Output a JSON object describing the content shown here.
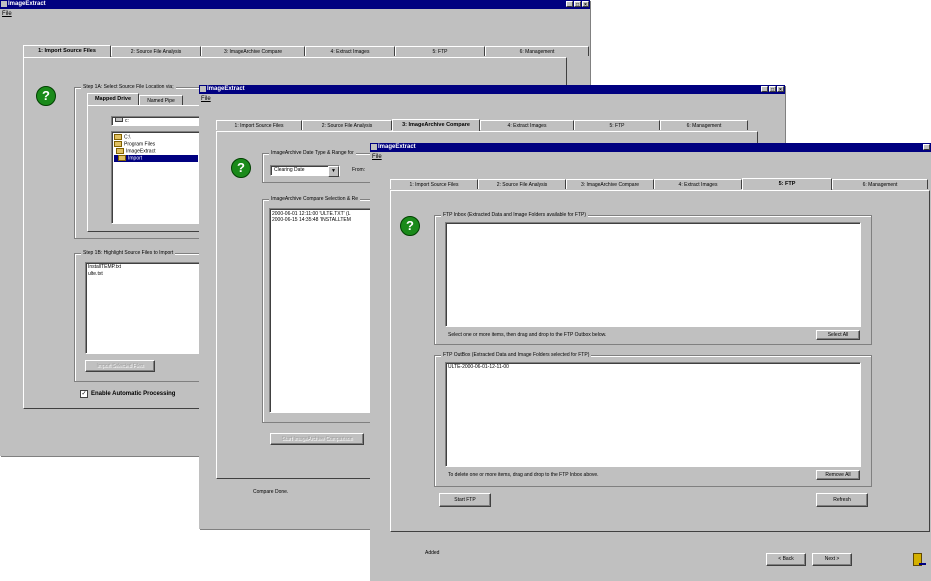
{
  "window1": {
    "title": "ImageExtract",
    "menu_file": "File",
    "tabs": [
      "1: Import Source Files",
      "2: Source File Analysis",
      "3: ImageArchive Compare",
      "4: Extract Images",
      "5: FTP",
      "6: Management"
    ],
    "step1a_label": "Step 1A: Select Source File Location via;",
    "subtab_mapped": "Mapped Drive",
    "subtab_pipe": "Named Pipe",
    "drive_value": "c:",
    "folders": [
      "C:\\",
      "Program Files",
      "ImageExtract",
      "Import"
    ],
    "step1b_label": "Step 1B: Highlight Source Files to Import",
    "files": [
      "InstallTEMP.txt",
      "ulte.txt"
    ],
    "import_button": "Import Selected Files",
    "auto_checkbox": "Enable Automatic Processing",
    "auto_checked": true
  },
  "window2": {
    "title": "ImageExtract",
    "menu_file": "File",
    "tabs": [
      "1: Import Source Files",
      "2: Source File Analysis",
      "3: ImageArchive Compare",
      "4: Extract Images",
      "5: FTP",
      "6: Management"
    ],
    "date_group_label": "ImageArchive Date Type & Range for",
    "date_type_value": "Clearing Date",
    "from_label": "From:",
    "compare_group_label": "ImageArchive Compare Selection & Re",
    "compare_rows": [
      "2000-06-01 12:11:00  'ULTE.TXT' (L",
      "2000-06-15 14:35:48  'INSTALLTEM"
    ],
    "start_compare_button": "Start ImageArchive Comparison",
    "status": "Compare Done."
  },
  "window3": {
    "title": "ImageExtract",
    "menu_file": "File",
    "tabs": [
      "1: Import Source Files",
      "2: Source File Analysis",
      "3: ImageArchive Compare",
      "4: Extract Images",
      "5: FTP",
      "6: Management"
    ],
    "inbox_label": "FTP Inbox (Extracted Data and Image Folders available for FTP)",
    "inbox_hint": "Select one or more items, then drag and drop to the FTP Outbox below.",
    "select_all_button": "Select All",
    "outbox_label": "FTP OutBox (Extracted Data and Image Folders selected for FTP)",
    "outbox_items": [
      "ULTE-2000-06-01-12-11-00"
    ],
    "outbox_hint": "To delete one or more items, drag and drop to the FTP Inbox above.",
    "remove_all_button": "Remove All",
    "start_ftp_button": "Start FTP",
    "refresh_button": "Refresh",
    "status": "Added",
    "back_button": "< Back",
    "next_button": "Next >"
  }
}
